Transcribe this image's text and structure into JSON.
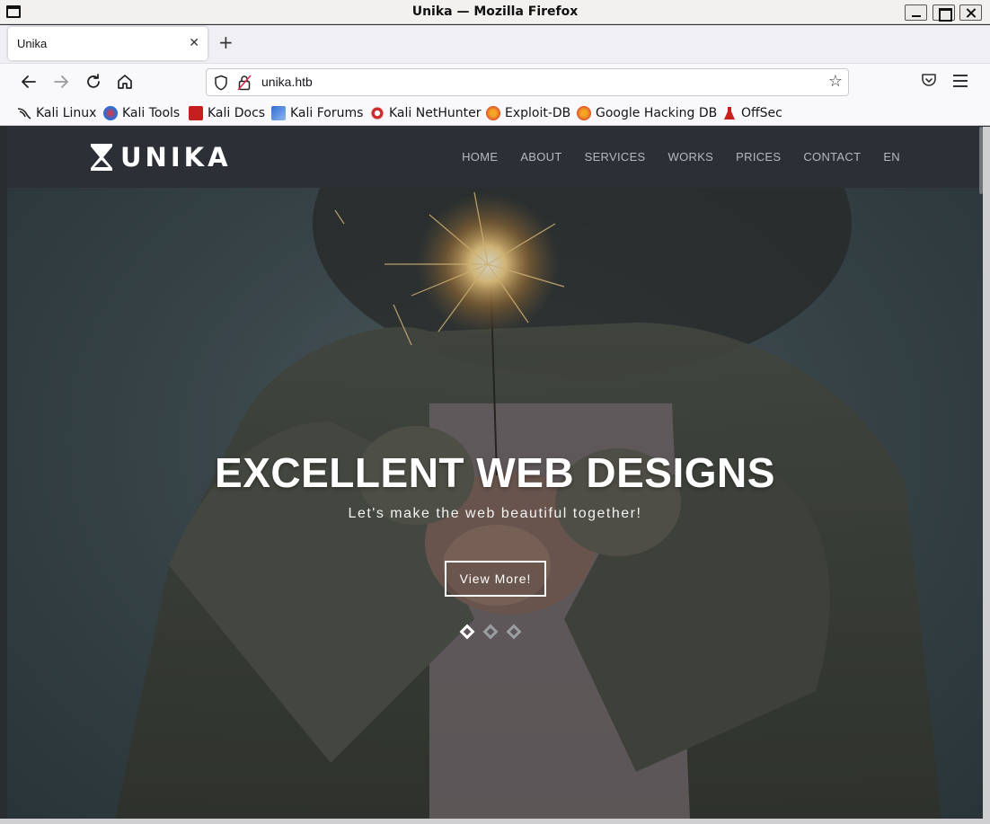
{
  "window": {
    "title": "Unika — Mozilla Firefox"
  },
  "tabs": [
    {
      "label": "Unika"
    }
  ],
  "toolbar": {
    "url": "unika.htb"
  },
  "bookmarks": [
    {
      "label": "Kali Linux",
      "icon": "kali-dragon-icon"
    },
    {
      "label": "Kali Tools",
      "icon": "kali-tools-icon"
    },
    {
      "label": "Kali Docs",
      "icon": "kali-docs-icon"
    },
    {
      "label": "Kali Forums",
      "icon": "kali-forums-icon"
    },
    {
      "label": "Kali NetHunter",
      "icon": "kali-nethunter-icon"
    },
    {
      "label": "Exploit-DB",
      "icon": "exploit-db-icon"
    },
    {
      "label": "Google Hacking DB",
      "icon": "ghdb-icon"
    },
    {
      "label": "OffSec",
      "icon": "offsec-icon"
    }
  ],
  "site": {
    "logo_text": "UNIKA",
    "nav": [
      "HOME",
      "ABOUT",
      "SERVICES",
      "WORKS",
      "PRICES",
      "CONTACT",
      "EN"
    ],
    "hero": {
      "title": "EXCELLENT WEB DESIGNS",
      "subtitle": "Let's make the web beautiful together!",
      "button": "View More!",
      "slides": 3,
      "active_slide": 1
    }
  }
}
